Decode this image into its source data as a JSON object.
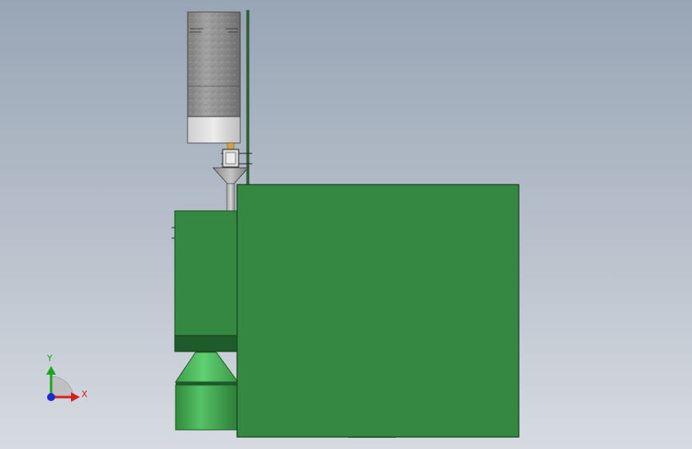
{
  "colors": {
    "background_top": "#98a5b5",
    "background_bottom": "#d7dbe1",
    "housing_green": "#358842",
    "cone_green": "#4fc061",
    "steel": "#8f8f8f",
    "axis_x": "#d42020",
    "axis_y": "#1aa51a",
    "axis_z": "#1a2bd4"
  },
  "triad": {
    "x_label": "X",
    "y_label": "Y"
  }
}
